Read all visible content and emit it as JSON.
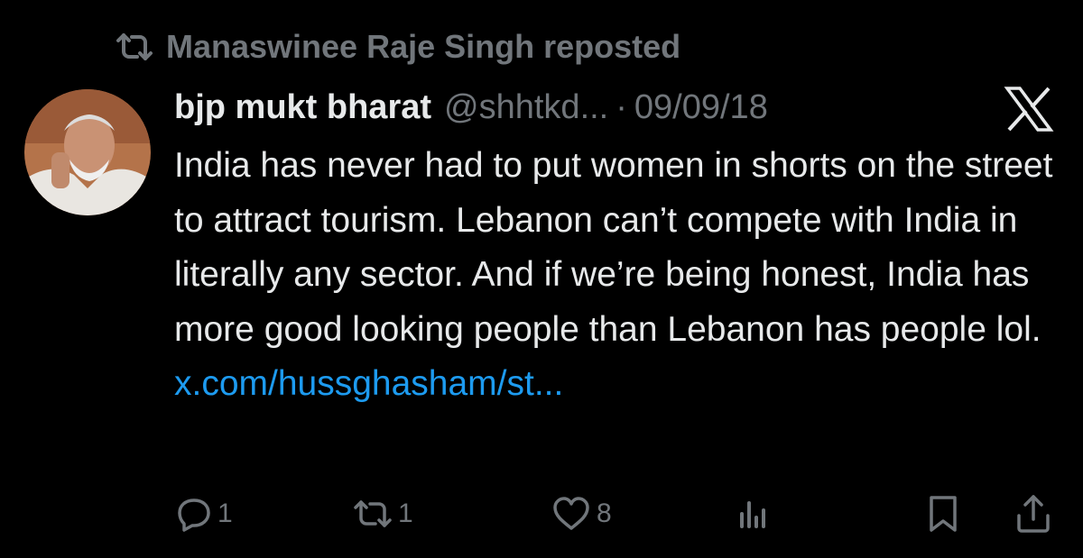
{
  "reposted_by": {
    "icon": "repost-icon",
    "label": "Manaswinee Raje Singh reposted"
  },
  "post": {
    "avatar": "avatar",
    "display_name": "bjp mukt bharat",
    "handle": "@shhtkd...",
    "separator": "·",
    "date": "09/09/18",
    "platform_icon": "x-logo-icon",
    "text": "India has never had to put women in shorts on the street to attract tourism. Lebanon can’t compete with India in literally any sector. And if we’re being honest, India has more good looking people than Lebanon has people lol. ",
    "link": "x.com/hussghasham/st..."
  },
  "actions": {
    "reply": {
      "icon": "reply-icon",
      "count": "1"
    },
    "repost": {
      "icon": "repost-icon",
      "count": "1"
    },
    "like": {
      "icon": "heart-icon",
      "count": "8"
    },
    "views": {
      "icon": "analytics-icon"
    },
    "bookmark": {
      "icon": "bookmark-icon"
    },
    "share": {
      "icon": "share-icon"
    }
  },
  "colors": {
    "background": "#000000",
    "primary_text": "#e7e9ea",
    "secondary_text": "#71767b",
    "link": "#1d9bf0"
  }
}
